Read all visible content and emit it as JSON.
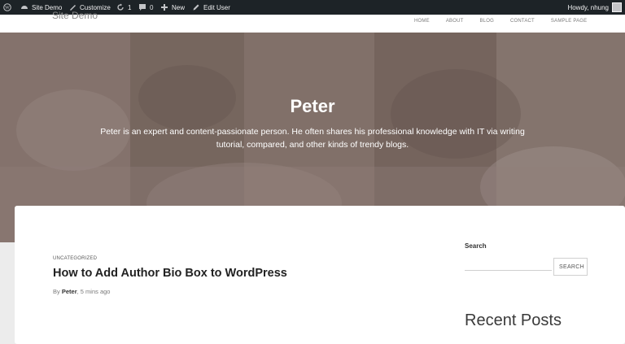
{
  "admin_bar": {
    "site_name": "Site Demo",
    "customize": "Customize",
    "updates_count": "1",
    "comments_count": "0",
    "new_label": "New",
    "edit_user": "Edit User",
    "howdy": "Howdy, nhung"
  },
  "header": {
    "site_title": "Site Demo",
    "nav": [
      "HOME",
      "ABOUT",
      "BLOG",
      "CONTACT",
      "SAMPLE PAGE"
    ]
  },
  "hero": {
    "title": "Peter",
    "description": "Peter is an expert and content-passionate person. He often shares his professional knowledge with IT via writing tutorial, compared, and other kinds of trendy blogs."
  },
  "post": {
    "category": "UNCATEGORIZED",
    "title": "How to Add Author Bio Box to WordPress",
    "meta_by": "By",
    "author": "Peter",
    "time": ", 5 mins ago"
  },
  "sidebar": {
    "search_title": "Search",
    "search_value": "",
    "search_button": "SEARCH",
    "recent_posts_title": "Recent Posts"
  },
  "colors": {
    "admin_bar_bg": "#1d2327",
    "hero_tint": "#8e7b72"
  }
}
